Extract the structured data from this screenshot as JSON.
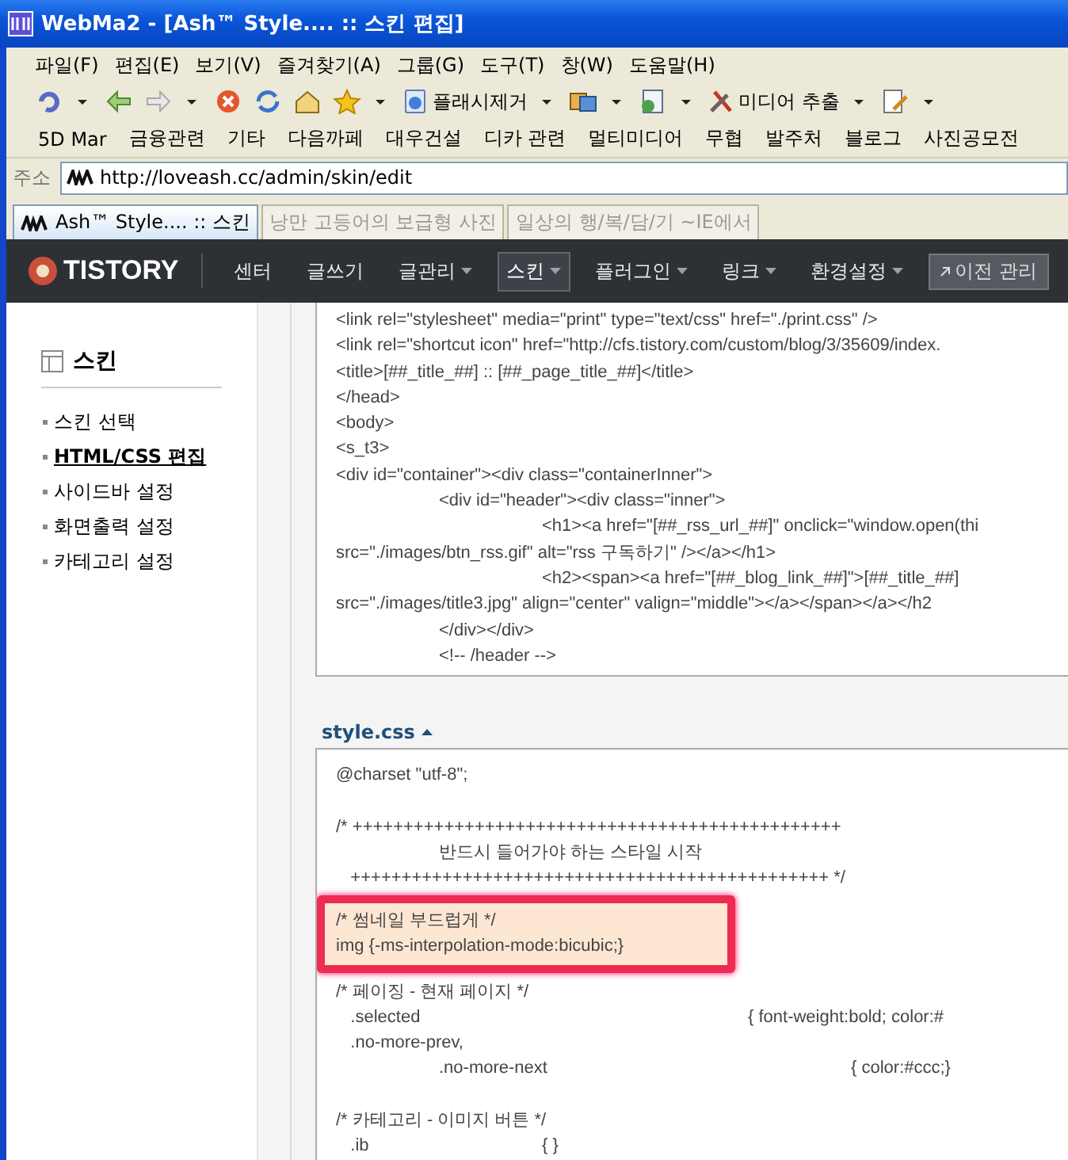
{
  "window": {
    "title": "WebMa2 - [Ash™ Style.... :: 스킨 편집]"
  },
  "menu": [
    "파일(F)",
    "편집(E)",
    "보기(V)",
    "즐겨찾기(A)",
    "그룹(G)",
    "도구(T)",
    "창(W)",
    "도움말(H)"
  ],
  "toolbar": [
    {
      "kind": "undo"
    },
    {
      "kind": "back"
    },
    {
      "kind": "forward",
      "disabled": true
    },
    {
      "kind": "stop"
    },
    {
      "kind": "refresh"
    },
    {
      "kind": "home"
    },
    {
      "kind": "favorites"
    },
    {
      "kind": "labeled",
      "label": "플래시제거"
    },
    {
      "kind": "group"
    },
    {
      "kind": "window"
    },
    {
      "kind": "labeled-tools",
      "label": "미디어 추출"
    },
    {
      "kind": "edit"
    }
  ],
  "links": [
    "5D Mar",
    "금융관련",
    "기타",
    "다음까페",
    "대우건설",
    "디카 관련",
    "멀티미디어",
    "무협",
    "발주처",
    "블로그",
    "사진공모전"
  ],
  "address": {
    "label": "주소",
    "value": "http://loveash.cc/admin/skin/edit"
  },
  "tabs": [
    {
      "label": "Ash™ Style.... :: 스킨",
      "selected": true
    },
    {
      "label": "낭만 고등어의 보급형 사진",
      "selected": false
    },
    {
      "label": "일상의 행/복/담/기 ~IE에서",
      "selected": false
    }
  ],
  "nav": {
    "logo": "TISTORY",
    "items": [
      {
        "label": "센터",
        "selected": false,
        "dropdown": false
      },
      {
        "label": "글쓰기",
        "selected": false,
        "dropdown": false
      },
      {
        "label": "글관리",
        "selected": false,
        "dropdown": true
      },
      {
        "label": "스킨",
        "selected": true,
        "dropdown": true
      },
      {
        "label": "플러그인",
        "selected": false,
        "dropdown": true
      },
      {
        "label": "링크",
        "selected": false,
        "dropdown": true
      },
      {
        "label": "환경설정",
        "selected": false,
        "dropdown": true
      }
    ],
    "button": "이전 관리"
  },
  "sidebar": {
    "title": "스킨",
    "items": [
      {
        "label": "스킨 선택",
        "selected": false
      },
      {
        "label": "HTML/CSS 편집",
        "selected": true
      },
      {
        "label": "사이드바 설정",
        "selected": false
      },
      {
        "label": "화면출력 설정",
        "selected": false
      },
      {
        "label": "카테고리 설정",
        "selected": false
      }
    ]
  },
  "html_code": [
    "<link rel=\"stylesheet\" media=\"print\" type=\"text/css\" href=\"./print.css\" />",
    "<link rel=\"shortcut icon\" href=\"http://cfs.tistory.com/custom/blog/3/35609/index.",
    "<title>[##_title_##] :: [##_page_title_##]</title>",
    "</head>",
    "<body>",
    "<s_t3>",
    "<div id=\"container\"><div class=\"containerInner\">",
    "\t<div id=\"header\"><div class=\"inner\">",
    "\t\t<h1><a href=\"[##_rss_url_##]\" onclick=\"window.open(thi",
    "src=\"./images/btn_rss.gif\" alt=\"rss 구독하기\" /></a></h1>",
    "\t\t<h2><span><a href=\"[##_blog_link_##]\">[##_title_##]",
    "src=\"./images/title3.jpg\" align=\"center\" valign=\"middle\"></a></span></a></h2",
    "\t</div></div>",
    "\t<!-- /header -->"
  ],
  "css_file": {
    "name": "style.css",
    "expanded": true,
    "segments": [
      {
        "highlighted": false,
        "lines": [
          "@charset \"utf-8\";"
        ]
      },
      {
        "highlighted": false,
        "lines": [
          "/* ++++++++++++++++++++++++++++++++++++++++++++++++",
          "\t반드시 들어가야 하는 스타일 시작",
          "   +++++++++++++++++++++++++++++++++++++++++++++++ */"
        ]
      },
      {
        "highlighted": true,
        "lines": [
          "/* 썸네일 부드럽게 */",
          "img {-ms-interpolation-mode:bicubic;}"
        ]
      },
      {
        "highlighted": false,
        "lines": [
          "/* 페이징 - 현재 페이지 */",
          "   .selected\t\t\t\t{ font-weight:bold; color:#",
          "   .no-more-prev,",
          "\t.no-more-next\t\t\t{ color:#ccc;}"
        ]
      },
      {
        "highlighted": false,
        "lines": [
          "/* 카테고리 - 이미지 버튼 */",
          "   .ib\t\t{ }"
        ]
      }
    ]
  }
}
